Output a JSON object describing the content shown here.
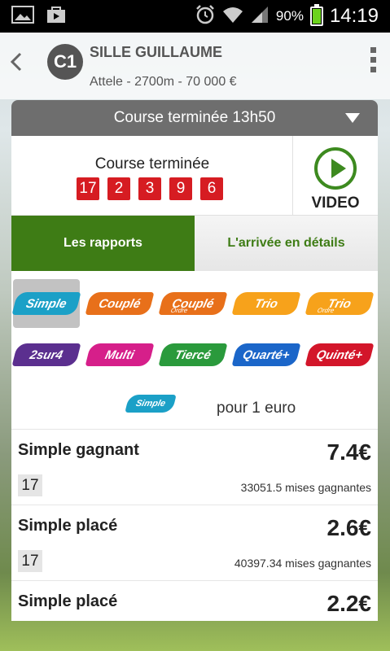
{
  "status_bar": {
    "battery_percent": "90%",
    "time": "14:19",
    "icons": [
      "picture-icon",
      "store-icon",
      "alarm-icon",
      "wifi-icon",
      "signal-icon",
      "battery-icon"
    ]
  },
  "header": {
    "back_icon": "chevron-left-icon",
    "badge": "C1",
    "race_name": "SILLE GUILLAUME",
    "race_info": "Attele - 2700m - 70 000 €"
  },
  "race_status": {
    "label": "Course terminée 13h50"
  },
  "result": {
    "title": "Course terminée",
    "numbers": [
      "17",
      "2",
      "3",
      "9",
      "6"
    ],
    "video_label": "VIDEO"
  },
  "tabs": [
    {
      "label": "Les rapports",
      "active": true
    },
    {
      "label": "L'arrivée en détails",
      "active": false
    }
  ],
  "bet_types_row1": [
    {
      "label": "Simple",
      "sub": "",
      "color": "#1ba0c7"
    },
    {
      "label": "Couplé",
      "sub": "",
      "color": "#e8701a"
    },
    {
      "label": "Couplé",
      "sub": "Ordre",
      "color": "#e8701a"
    },
    {
      "label": "Trio",
      "sub": "",
      "color": "#f7a21b"
    },
    {
      "label": "Trio",
      "sub": "Ordre",
      "color": "#f7a21b"
    }
  ],
  "bet_types_row2": [
    {
      "label": "2sur4",
      "sub": "",
      "color": "#5b2f8f"
    },
    {
      "label": "Multi",
      "sub": "",
      "color": "#d61f8a"
    },
    {
      "label": "Tiercé",
      "sub": "",
      "color": "#2a9a3c"
    },
    {
      "label": "Quarté+",
      "sub": "",
      "color": "#1b66c9"
    },
    {
      "label": "Quinté+",
      "sub": "",
      "color": "#d3162a"
    }
  ],
  "per_euro": {
    "chip": "Simple",
    "text": "pour 1 euro"
  },
  "payouts": [
    {
      "name": "Simple gagnant",
      "value": "7.4€",
      "horse": "17",
      "mises": "33051.5 mises gagnantes"
    },
    {
      "name": "Simple placé",
      "value": "2.6€",
      "horse": "17",
      "mises": "40397.34 mises gagnantes"
    },
    {
      "name": "Simple placé",
      "value": "2.2€"
    }
  ]
}
